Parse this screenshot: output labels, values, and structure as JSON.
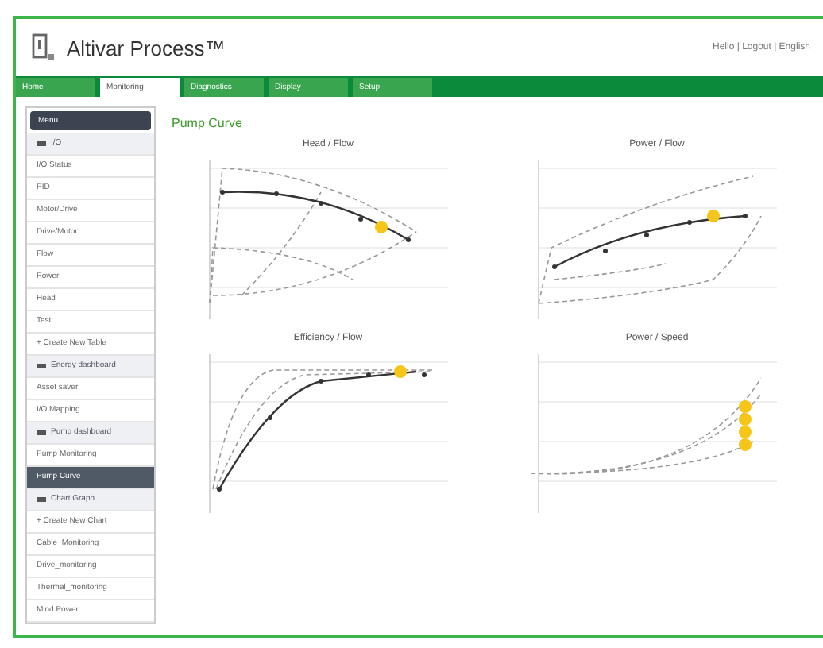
{
  "header": {
    "title": "Altivar Process™",
    "user_links": "Hello | Logout | English"
  },
  "tabs": [
    {
      "label": "Home",
      "selected": false
    },
    {
      "label": "Monitoring",
      "selected": true
    },
    {
      "label": "Diagnostics",
      "selected": false
    },
    {
      "label": "Display",
      "selected": false
    },
    {
      "label": "Setup",
      "selected": false
    }
  ],
  "sidebar": {
    "title": "Menu",
    "items": [
      {
        "kind": "group",
        "label": "I/O",
        "selected": false
      },
      {
        "kind": "item",
        "label": "I/O Status",
        "selected": false
      },
      {
        "kind": "item",
        "label": "PID",
        "selected": false
      },
      {
        "kind": "item",
        "label": "Motor/Drive",
        "selected": false
      },
      {
        "kind": "item",
        "label": "Drive/Motor",
        "selected": false
      },
      {
        "kind": "item",
        "label": "Flow",
        "selected": false
      },
      {
        "kind": "item",
        "label": "Power",
        "selected": false
      },
      {
        "kind": "item",
        "label": "Head",
        "selected": false
      },
      {
        "kind": "item",
        "label": "Test",
        "selected": false
      },
      {
        "kind": "item",
        "label": "+ Create New Table",
        "selected": false
      },
      {
        "kind": "group",
        "label": "Energy dashboard",
        "selected": false
      },
      {
        "kind": "item",
        "label": "Asset saver",
        "selected": false
      },
      {
        "kind": "item",
        "label": "I/O Mapping",
        "selected": false
      },
      {
        "kind": "group",
        "label": "Pump dashboard",
        "selected": false
      },
      {
        "kind": "item",
        "label": "Pump Monitoring",
        "selected": false
      },
      {
        "kind": "item",
        "label": "Pump Curve",
        "selected": true
      },
      {
        "kind": "group",
        "label": "Chart Graph",
        "selected": false
      },
      {
        "kind": "item",
        "label": "+ Create New Chart",
        "selected": false
      },
      {
        "kind": "item",
        "label": "Cable_Monitoring",
        "selected": false
      },
      {
        "kind": "item",
        "label": "Drive_monitoring",
        "selected": false
      },
      {
        "kind": "item",
        "label": "Thermal_monitoring",
        "selected": false
      },
      {
        "kind": "item",
        "label": "Mind Power",
        "selected": false
      }
    ]
  },
  "page_title": "Pump Curve",
  "charts": [
    {
      "title": "Head / Flow",
      "kind": "head"
    },
    {
      "title": "Power / Flow",
      "kind": "power"
    },
    {
      "title": "Efficiency / Flow",
      "kind": "efficiency"
    },
    {
      "title": "Power / Speed",
      "kind": "speed"
    }
  ]
}
